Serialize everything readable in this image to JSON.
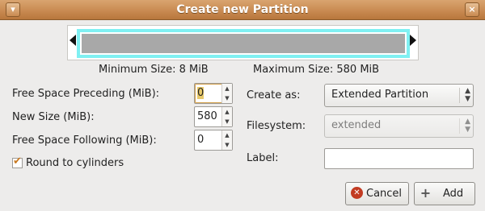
{
  "window": {
    "title": "Create new Partition",
    "menu_icon": "window-menu-icon",
    "close_icon": "close-icon",
    "close_glyph": "×"
  },
  "visual": {
    "minimum_size": "Minimum Size: 8 MiB",
    "maximum_size": "Maximum Size: 580 MiB",
    "colors": {
      "frame": "#7ff0f2",
      "fill": "#a8a8a8"
    }
  },
  "fields": {
    "free_space_preceding": {
      "label": "Free Space Preceding (MiB):",
      "value": "0"
    },
    "new_size": {
      "label": "New Size (MiB):",
      "value": "580"
    },
    "free_space_following": {
      "label": "Free Space Following (MiB):",
      "value": "0"
    },
    "round_to_cylinders": {
      "label": "Round to cylinders",
      "checked": true
    },
    "create_as": {
      "label": "Create as:",
      "value": "Extended Partition"
    },
    "filesystem": {
      "label": "Filesystem:",
      "value": "extended",
      "disabled": true
    },
    "partition_label": {
      "label": "Label:",
      "value": ""
    }
  },
  "buttons": {
    "cancel": {
      "label": "Cancel",
      "icon": "cancel-icon"
    },
    "add": {
      "label": "Add",
      "icon": "add-icon"
    }
  }
}
